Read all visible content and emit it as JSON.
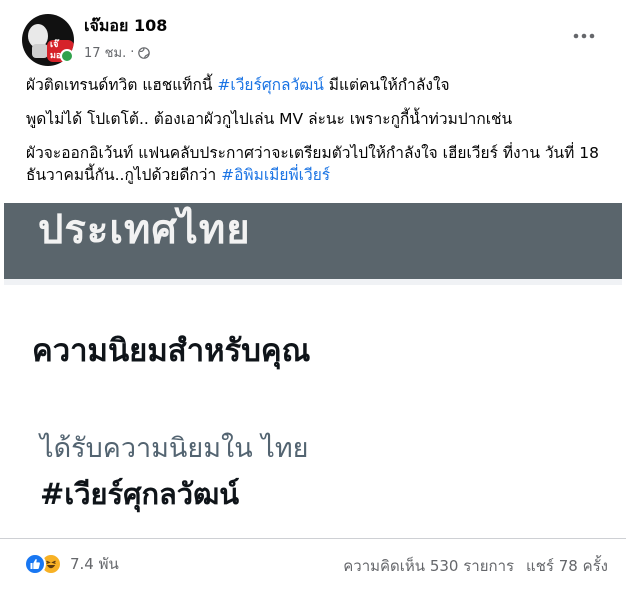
{
  "post": {
    "author": "เจ๊มอย 108",
    "time": "17 ชม.",
    "time_separator": "·",
    "avatar_badge": "เจ๊มอย",
    "paragraphs": [
      {
        "before": "ผัวติดเทรนด์ทวิต แฮชแท็กนี้ ",
        "hashtag": "#เวียร์ศุกลวัฒน์",
        "after": "  มีแต่คนให้กำลังใจ"
      },
      {
        "before": "พูดไม่ได้ โปเตโต้.. ต้องเอาผัวกูไปเล่น MV ล่ะนะ เพราะกูกี้น้ำท่วมปากเช่น",
        "hashtag": "",
        "after": ""
      },
      {
        "before": "ผัวจะออกอิเว้นท์ แฟนคลับประกาศว่าจะเตรียมตัวไปให้กำลังใจ เฮียเวียร์ ที่งาน วันที่ 18 ธันวาคมนี้กัน..กูไปด้วยดีกว่า ",
        "hashtag": "#อิพิมเมียพี่เวียร์",
        "after": ""
      }
    ]
  },
  "embed": {
    "banner_text": "ประเทศไทย",
    "heading": "ความนิยมสำหรับคุณ",
    "subheading": "ได้รับความนิยมใน ไทย",
    "trend": "#เวียร์ศุกลวัฒน์"
  },
  "footer": {
    "reaction_count": "7.4 พัน",
    "comments": "ความคิดเห็น 530 รายการ",
    "shares": "แชร์ 78 ครั้ง"
  },
  "icons": {
    "more": "more-options-icon",
    "globe": "globe-icon",
    "like": "like-reaction-icon",
    "haha": "haha-reaction-icon"
  },
  "colors": {
    "hashtag": "#1b74e4",
    "online": "#31a24c",
    "like": "#1877f2",
    "haha": "#f7b125",
    "banner": "#5a656c"
  }
}
